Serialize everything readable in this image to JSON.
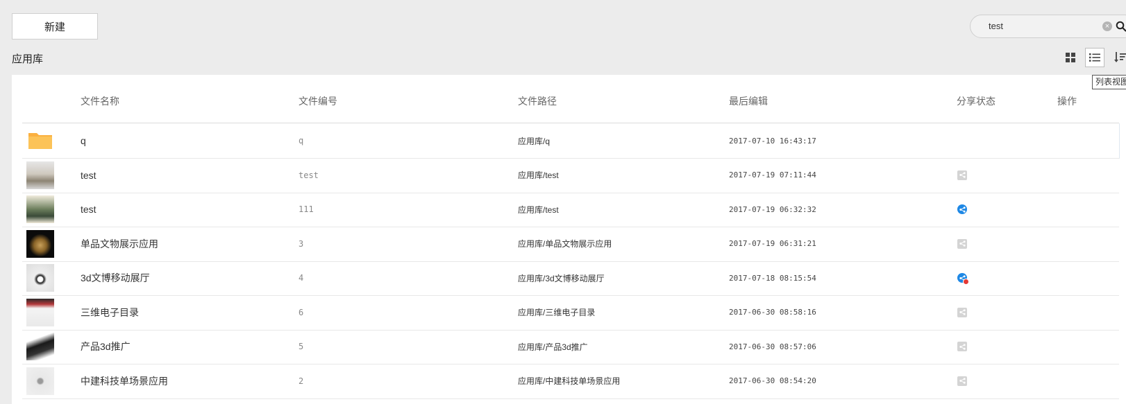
{
  "toolbar": {
    "new_label": "新建"
  },
  "search": {
    "value": "test"
  },
  "section": {
    "title": "应用库"
  },
  "view": {
    "tooltip": "列表视图"
  },
  "columns": {
    "name": "文件名称",
    "code": "文件编号",
    "path": "文件路径",
    "edited": "最后编辑",
    "share": "分享状态",
    "actions": "操作"
  },
  "rows": [
    {
      "thumb": "folder-icon",
      "name": "q",
      "code": "q",
      "path": "应用库/q",
      "edited": "2017-07-10 16:43:17",
      "share": "none"
    },
    {
      "thumb": "thumbnail-image",
      "name": "test",
      "code": "test",
      "path": "应用库/test",
      "edited": "2017-07-19 07:11:44",
      "share": "not-shared"
    },
    {
      "thumb": "thumbnail-image",
      "name": "test",
      "code": "111",
      "path": "应用库/test",
      "edited": "2017-07-19 06:32:32",
      "share": "shared"
    },
    {
      "thumb": "thumbnail-image",
      "name": "单品文物展示应用",
      "code": "3",
      "path": "应用库/单品文物展示应用",
      "edited": "2017-07-19 06:31:21",
      "share": "not-shared"
    },
    {
      "thumb": "thumbnail-image",
      "name": "3d文博移动展厅",
      "code": "4",
      "path": "应用库/3d文博移动展厅",
      "edited": "2017-07-18 08:15:54",
      "share": "shared-alert"
    },
    {
      "thumb": "thumbnail-image",
      "name": "三维电子目录",
      "code": "6",
      "path": "应用库/三维电子目录",
      "edited": "2017-06-30 08:58:16",
      "share": "not-shared"
    },
    {
      "thumb": "thumbnail-image",
      "name": "产品3d推广",
      "code": "5",
      "path": "应用库/产品3d推广",
      "edited": "2017-06-30 08:57:06",
      "share": "not-shared"
    },
    {
      "thumb": "thumbnail-image",
      "name": "中建科技单场景应用",
      "code": "2",
      "path": "应用库/中建科技单场景应用",
      "edited": "2017-06-30 08:54:20",
      "share": "not-shared"
    }
  ],
  "colors": {
    "accent": "#1e88e5",
    "folder": "#fbb040",
    "alert": "#e53935"
  }
}
